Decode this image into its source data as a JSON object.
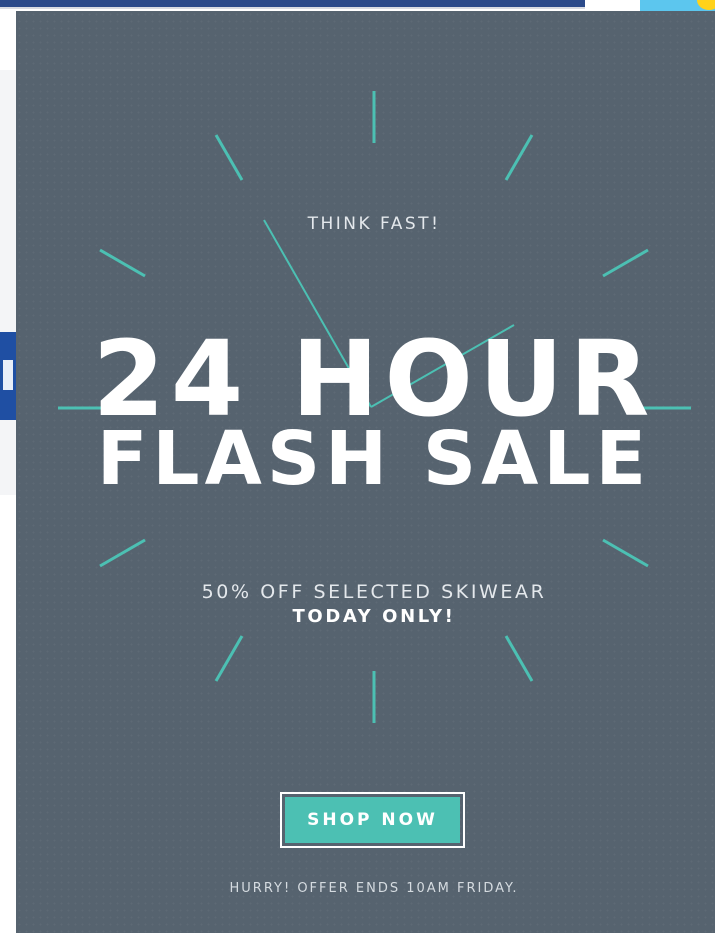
{
  "colors": {
    "modal_background": "#56636f",
    "accent": "#4cc0b3",
    "text_primary": "#ffffff",
    "text_secondary": "#e4e8ec",
    "background_page_bar": "#2b4a8a"
  },
  "promo": {
    "eyebrow": "THINK FAST!",
    "headline_line1": "24 HOUR",
    "headline_line2": "FLASH SALE",
    "offer": "50% OFF SELECTED SKIWEAR",
    "offer_emphasis": "TODAY ONLY!",
    "cta_label": "SHOP NOW",
    "footnote": "HURRY! OFFER ENDS 10AM FRIDAY."
  },
  "icons": {
    "clock_graphic": "clock-icon"
  }
}
